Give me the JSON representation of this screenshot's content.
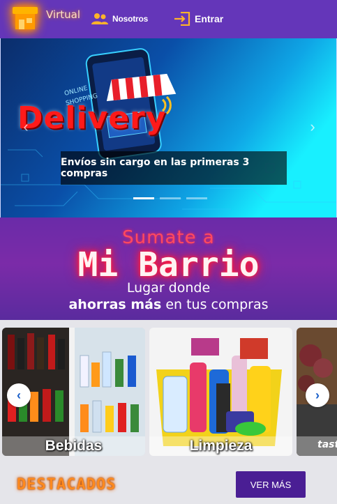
{
  "colors": {
    "navbar": "#6436b9",
    "promo_bg": "#6a2ba8",
    "button": "#4a1e94",
    "accent_orange": "#ff8a1e",
    "neon_red": "#ff1a3c"
  },
  "navbar": {
    "brand_text": "Virtual",
    "brand_icon": "storefront-icon",
    "links": [
      {
        "label": "Nosotros",
        "icon": "users-icon"
      },
      {
        "label": "Entrar",
        "icon": "login-icon"
      }
    ]
  },
  "carousel": {
    "slide_title": "Delivery",
    "caption": "Envíos sin cargo en las primeras 3 compras",
    "prev_icon": "chevron-left-icon",
    "next_icon": "chevron-right-icon",
    "indicators_count": 3,
    "active_index": 0
  },
  "promo": {
    "top_text": "Sumate a",
    "title": "Mi Barrio",
    "line1": "Lugar donde",
    "line2_bold": "ahorras más",
    "line2_rest": " en tus compras"
  },
  "categories": {
    "items": [
      {
        "label": "Bebidas"
      },
      {
        "label": "Limpieza"
      },
      {
        "label": ""
      }
    ],
    "prev_icon": "chevron-left-icon",
    "next_icon": "chevron-right-icon"
  },
  "featured": {
    "title": "DESTACADOS",
    "button_label": "VER MÁS"
  }
}
